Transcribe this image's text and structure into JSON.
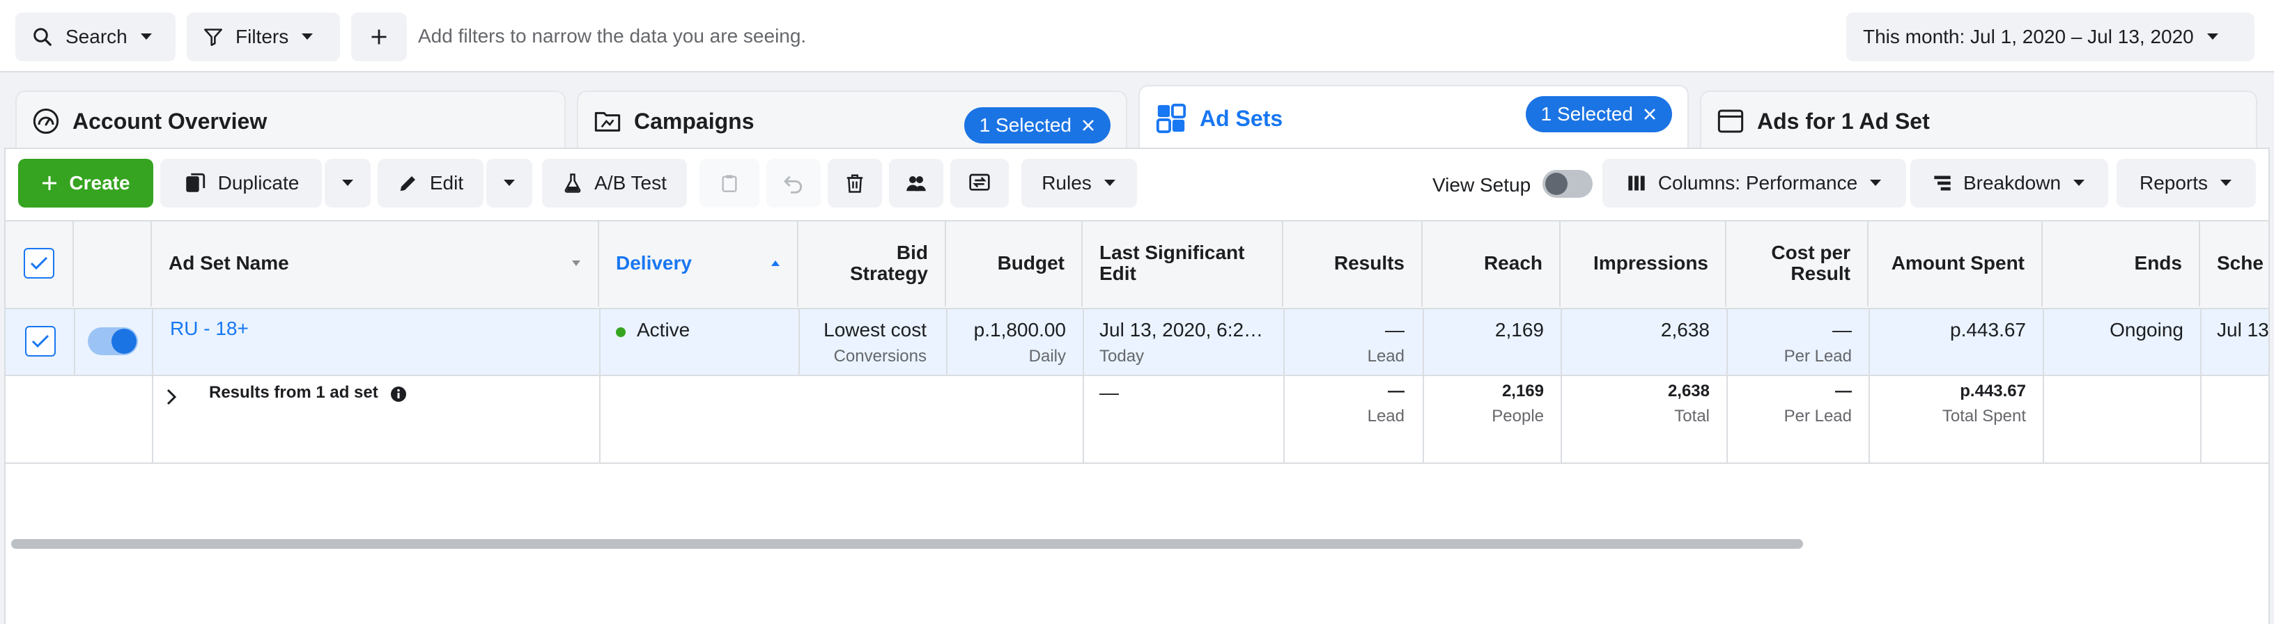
{
  "filterbar": {
    "search_label": "Search",
    "filters_label": "Filters",
    "add_icon": "plus-icon",
    "hint": "Add filters to narrow the data you are seeing.",
    "date_range": "This month: Jul 1, 2020 – Jul 13, 2020"
  },
  "tabs": [
    {
      "title": "Account Overview",
      "icon": "gauge-icon"
    },
    {
      "title": "Campaigns",
      "icon": "folder-icon",
      "badge": "1 Selected"
    },
    {
      "title": "Ad Sets",
      "icon": "grid-icon",
      "badge": "1 Selected"
    },
    {
      "title": "Ads for 1 Ad Set",
      "icon": "window-icon"
    }
  ],
  "toolbar": {
    "create": "Create",
    "duplicate": "Duplicate",
    "edit": "Edit",
    "ab_test": "A/B Test",
    "rules": "Rules",
    "view_setup": "View Setup",
    "columns": "Columns: Performance",
    "breakdown": "Breakdown",
    "reports": "Reports"
  },
  "columns": {
    "name": "Ad Set Name",
    "delivery": "Delivery",
    "bid_strategy": "Bid Strategy",
    "budget": "Budget",
    "last_edit": "Last Significant Edit",
    "results": "Results",
    "reach": "Reach",
    "impressions": "Impressions",
    "cost_per_result": "Cost per Result",
    "amount_spent": "Amount Spent",
    "ends": "Ends",
    "schedule": "Sche"
  },
  "row": {
    "name": "RU - 18+",
    "delivery": "Active",
    "bid_strategy": "Lowest cost",
    "bid_strategy_sub": "Conversions",
    "budget": "p.1,800.00",
    "budget_sub": "Daily",
    "last_edit": "Jul 13, 2020, 6:2…",
    "last_edit_sub": "Today",
    "results": "—",
    "results_sub": "Lead",
    "reach": "2,169",
    "impressions": "2,638",
    "cost_per_result": "—",
    "cost_per_result_sub": "Per Lead",
    "amount_spent": "p.443.67",
    "ends": "Ongoing",
    "schedule": "Jul 13"
  },
  "summary": {
    "label": "Results from 1 ad set",
    "last_edit": "—",
    "results": "—",
    "results_sub": "Lead",
    "reach": "2,169",
    "reach_sub": "People",
    "impressions": "2,638",
    "impressions_sub": "Total",
    "cost_per_result": "—",
    "cost_per_result_sub": "Per Lead",
    "amount_spent": "p.443.67",
    "amount_spent_sub": "Total Spent"
  },
  "colors": {
    "accent": "#1877f2",
    "create_green": "#36a420",
    "selected_row": "#eaf3ff"
  }
}
